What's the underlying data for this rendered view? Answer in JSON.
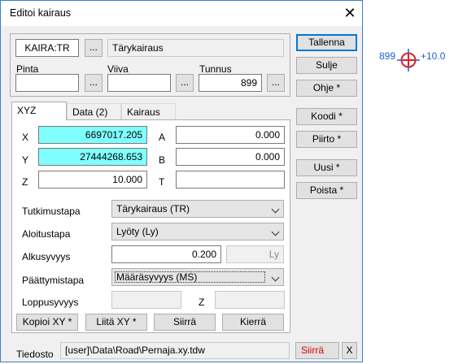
{
  "dialog": {
    "title": "Editoi kairaus",
    "close_glyph": "✕"
  },
  "top": {
    "code": "KAIRA:TR",
    "code_browse": "...",
    "type_name": "Tärykairaus",
    "pinta_label": "Pinta",
    "pinta_value": "",
    "viiva_label": "Viiva",
    "viiva_value": "",
    "tunnus_label": "Tunnus",
    "tunnus_value": "899",
    "browse": "..."
  },
  "tabs": [
    {
      "label": "XYZ",
      "active": true
    },
    {
      "label": "Data (2)",
      "active": false
    },
    {
      "label": "Kairaus",
      "active": false
    }
  ],
  "xyz": {
    "x_label": "X",
    "x_value": "6697017.205",
    "y_label": "Y",
    "y_value": "27444268.653",
    "z_label": "Z",
    "z_value": "10.000",
    "a_label": "A",
    "a_value": "0.000",
    "b_label": "B",
    "b_value": "0.000",
    "t_label": "T",
    "t_value": ""
  },
  "form": {
    "tutkimustapa_label": "Tutkimustapa",
    "tutkimustapa_value": "Tärykairaus (TR)",
    "aloitustapa_label": "Aloitustapa",
    "aloitustapa_value": "Lyöty (Ly)",
    "alkusyvyys_label": "Alkusyvyys",
    "alkusyvyys_value": "0.200",
    "alkusyvyys_unit": "Ly",
    "paattymistapa_label": "Päättymistapa",
    "paattymistapa_value": "Määräsyvyys (MS)",
    "loppusyvyys_label": "Loppusyvyys",
    "loppusyvyys_value": "",
    "z_label": "Z",
    "z_value": ""
  },
  "bottom_buttons": {
    "kopioi": "Kopioi XY *",
    "liita": "Liitä XY *",
    "siirra": "Siirrä",
    "kierra": "Kierrä"
  },
  "file": {
    "label": "Tiedosto",
    "path": "[user]\\Data\\Road\\Pernaja.xy.tdw",
    "move": "Siirrä",
    "x": "X"
  },
  "side_buttons": {
    "tallenna": "Tallenna",
    "sulje": "Sulje",
    "ohje": "Ohje *",
    "koodi": "Koodi *",
    "piirto": "Piirto *",
    "uusi": "Uusi *",
    "poista": "Poista *"
  },
  "canvas": {
    "point_id": "899",
    "point_z": "+10.0",
    "symbol_color": "#e02020",
    "label_color": "#1f5fd8"
  },
  "colors": {
    "accent": "#0078d7",
    "highlight_field": "#80ffff",
    "move_text": "#e00000"
  }
}
